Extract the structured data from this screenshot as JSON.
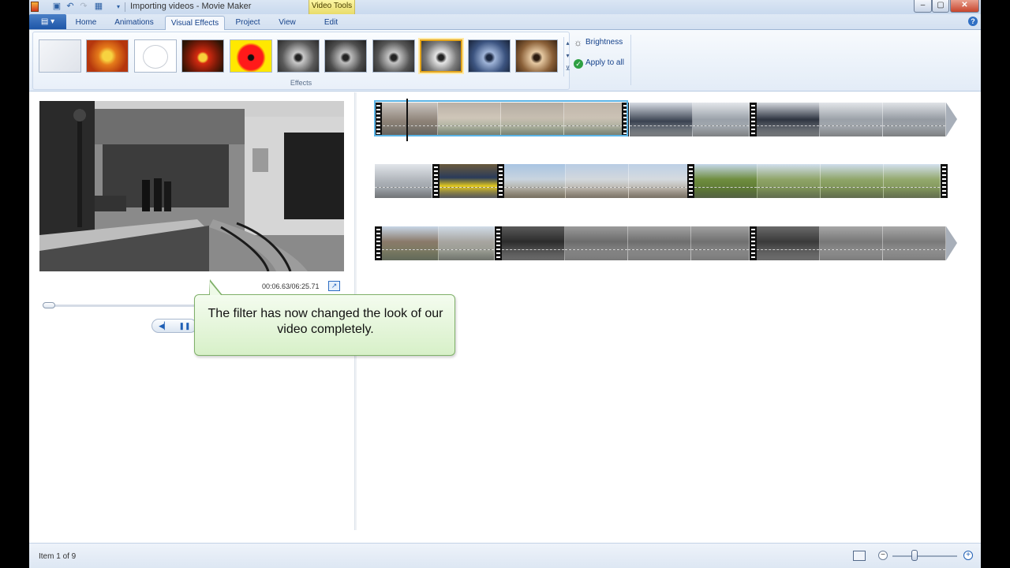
{
  "window": {
    "title": "Importing videos - Movie Maker",
    "contextual_tab_group": "Video Tools",
    "controls": {
      "minimize": "–",
      "maximize": "▢",
      "close": "✕"
    }
  },
  "quick_access": [
    "save-icon",
    "undo-icon",
    "redo-icon",
    "layout-icon",
    "customize-dropdown-icon"
  ],
  "tabs": [
    {
      "label": "Home",
      "active": false
    },
    {
      "label": "Animations",
      "active": false
    },
    {
      "label": "Visual Effects",
      "active": true
    },
    {
      "label": "Project",
      "active": false
    },
    {
      "label": "View",
      "active": false
    },
    {
      "label": "Edit",
      "active": false
    }
  ],
  "ribbon": {
    "effects_group_label": "Effects",
    "effects_selected_index": 8,
    "brightness_label": "Brightness",
    "apply_all_label": "Apply to all"
  },
  "preview": {
    "time": "00:06.63/06:25.71",
    "effect": "black-and-white"
  },
  "callout": {
    "text": "The filter has now changed the look of our video completely."
  },
  "status": {
    "text": "Item 1 of 9"
  },
  "colors": {
    "ribbon_bg": "#e3ecf7",
    "selection_border": "#e3a51c",
    "clip_selection": "#5bb4e6",
    "callout_bg": "#d7f0c8"
  }
}
